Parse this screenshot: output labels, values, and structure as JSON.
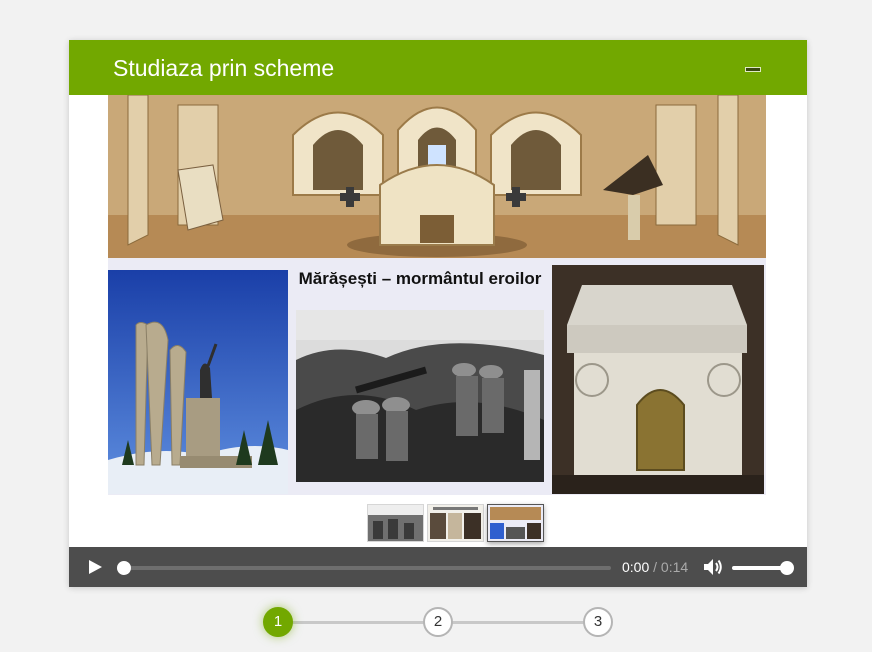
{
  "header": {
    "title": "Studiaza prin scheme"
  },
  "slide": {
    "center_title": "Mărășești – mormântul eroilor"
  },
  "player": {
    "current_time": "0:00",
    "separator": "/",
    "duration": "0:14",
    "progress": 0,
    "volume": 1.0
  },
  "thumbnails": [
    {
      "index": 1,
      "active": false
    },
    {
      "index": 2,
      "active": false
    },
    {
      "index": 3,
      "active": true
    }
  ],
  "steps": [
    {
      "label": "1",
      "active": true
    },
    {
      "label": "2",
      "active": false
    },
    {
      "label": "3",
      "active": false
    }
  ],
  "colors": {
    "accent": "#72a800",
    "player_bg": "#4d4d4d"
  }
}
